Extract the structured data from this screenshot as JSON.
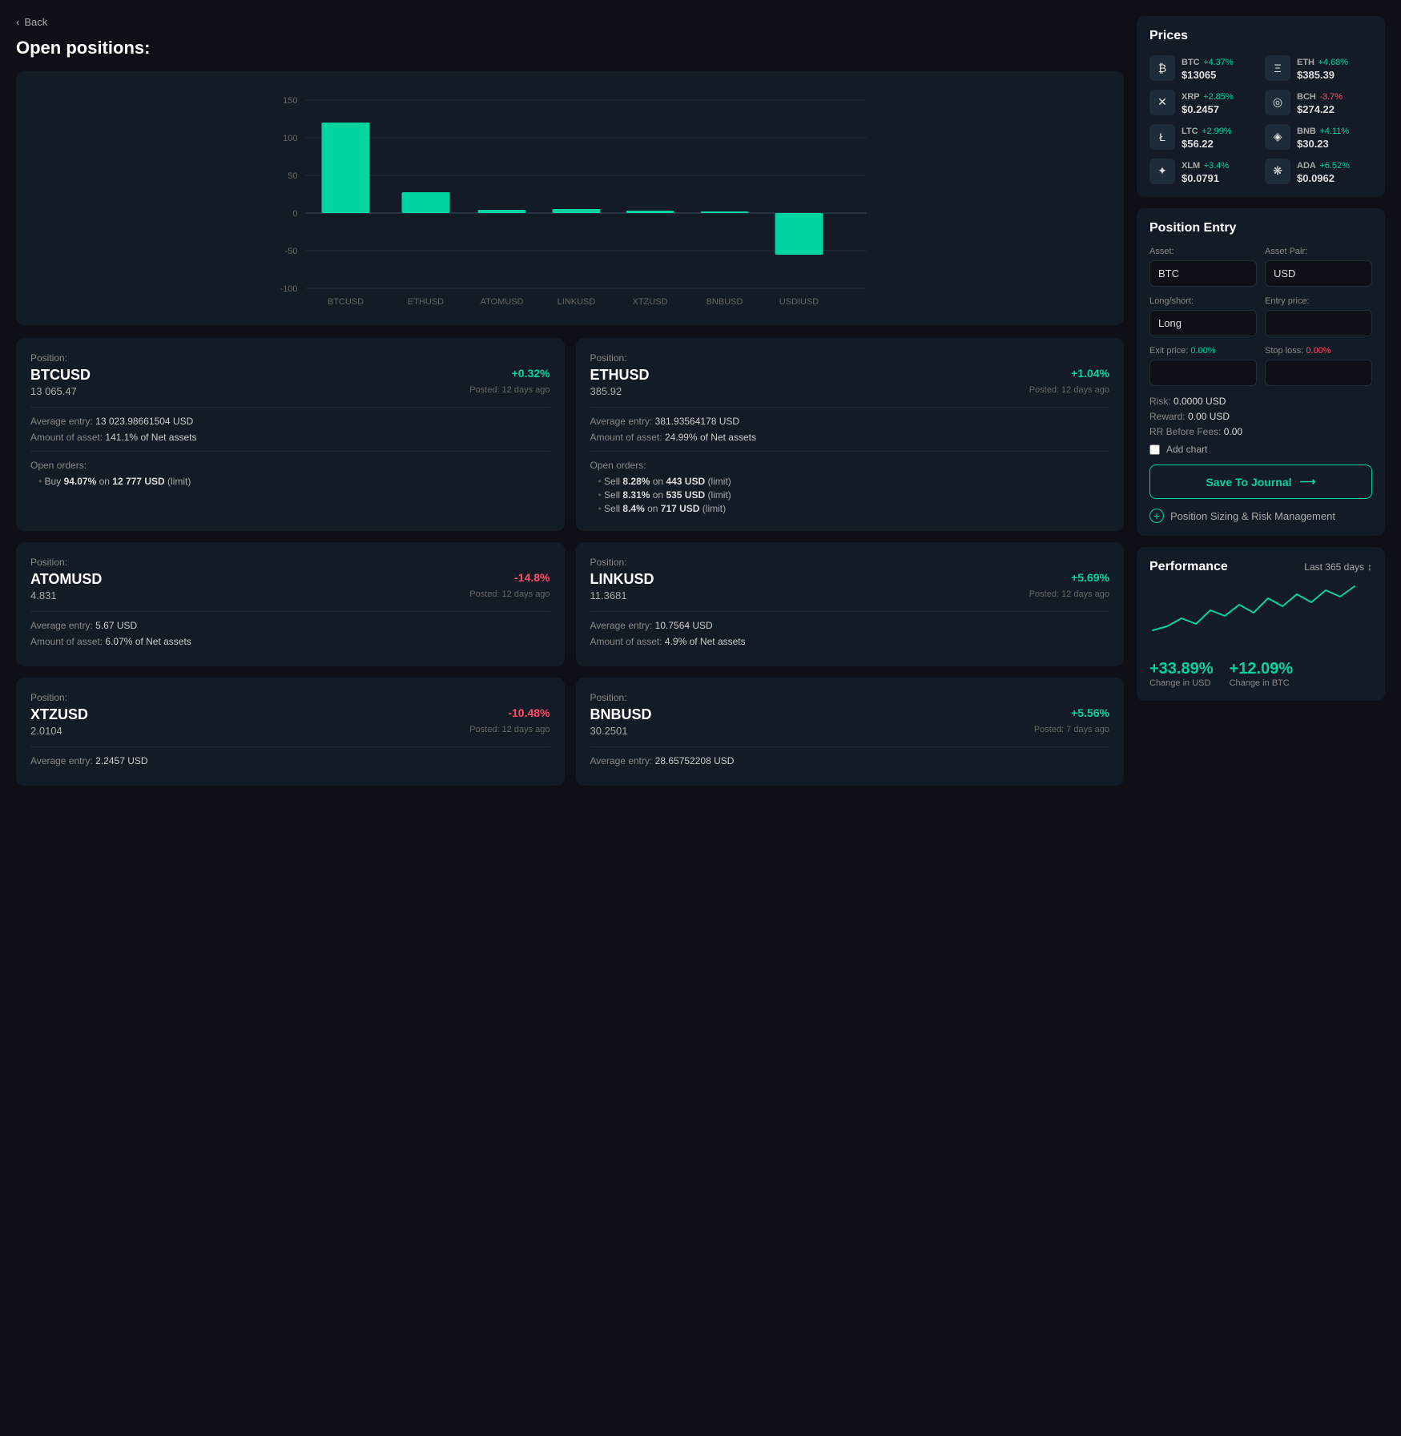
{
  "nav": {
    "back_label": "Back"
  },
  "page": {
    "title": "Open positions:"
  },
  "chart": {
    "bars": [
      {
        "label": "BTCUSD",
        "value": 120
      },
      {
        "label": "ETHUSD",
        "value": 28
      },
      {
        "label": "ATOMUSD",
        "value": 4
      },
      {
        "label": "LINKUSD",
        "value": 5
      },
      {
        "label": "XTZUSD",
        "value": 3
      },
      {
        "label": "BNBUSD",
        "value": 2
      },
      {
        "label": "USDIUSD",
        "value": -55
      }
    ],
    "y_labels": [
      "150",
      "100",
      "50",
      "0",
      "-50",
      "-100"
    ]
  },
  "positions": [
    {
      "label": "Position:",
      "name": "BTCUSD",
      "change": "+0.32%",
      "change_type": "pos",
      "price": "13 065.47",
      "posted": "Posted: 12 days ago",
      "avg_entry": "13 023.98661504 USD",
      "amount": "141.1%",
      "amount_label": "of Net assets",
      "orders_title": "Open orders:",
      "orders": [
        "Buy 94.07% on 12 777 USD (limit)"
      ]
    },
    {
      "label": "Position:",
      "name": "ETHUSD",
      "change": "+1.04%",
      "change_type": "pos",
      "price": "385.92",
      "posted": "Posted: 12 days ago",
      "avg_entry": "381.93564178 USD",
      "amount": "24.99%",
      "amount_label": "of Net assets",
      "orders_title": "Open orders:",
      "orders": [
        "Sell 8.28% on 443 USD (limit)",
        "Sell 8.31% on 535 USD (limit)",
        "Sell 8.4% on 717 USD (limit)"
      ]
    },
    {
      "label": "Position:",
      "name": "ATOMUSD",
      "change": "-14.8%",
      "change_type": "neg",
      "price": "4.831",
      "posted": "Posted: 12 days ago",
      "avg_entry": "5.67 USD",
      "amount": "6.07%",
      "amount_label": "of Net assets",
      "orders_title": "",
      "orders": []
    },
    {
      "label": "Position:",
      "name": "LINKUSD",
      "change": "+5.69%",
      "change_type": "pos",
      "price": "11.3681",
      "posted": "Posted: 12 days ago",
      "avg_entry": "10.7564 USD",
      "amount": "4.9%",
      "amount_label": "of Net assets",
      "orders_title": "",
      "orders": []
    },
    {
      "label": "Position:",
      "name": "XTZUSD",
      "change": "-10.48%",
      "change_type": "neg",
      "price": "2.0104",
      "posted": "Posted: 12 days ago",
      "avg_entry": "2.2457 USD",
      "amount": "",
      "amount_label": "",
      "orders_title": "",
      "orders": []
    },
    {
      "label": "Position:",
      "name": "BNBUSD",
      "change": "+5.56%",
      "change_type": "pos",
      "price": "30.2501",
      "posted": "Posted: 7 days ago",
      "avg_entry": "28.65752208 USD",
      "amount": "",
      "amount_label": "",
      "orders_title": "",
      "orders": []
    }
  ],
  "prices": {
    "title": "Prices",
    "items": [
      {
        "symbol": "BTC",
        "icon": "₿",
        "change": "+4.37%",
        "change_type": "pos",
        "value": "$13065"
      },
      {
        "symbol": "ETH",
        "icon": "Ξ",
        "change": "+4.68%",
        "change_type": "pos",
        "value": "$385.39"
      },
      {
        "symbol": "XRP",
        "icon": "✕",
        "change": "+2.85%",
        "change_type": "pos",
        "value": "$0.2457"
      },
      {
        "symbol": "BCH",
        "icon": "◎",
        "change": "-3.7%",
        "change_type": "neg",
        "value": "$274.22"
      },
      {
        "symbol": "LTC",
        "icon": "Ł",
        "change": "+2.99%",
        "change_type": "pos",
        "value": "$56.22"
      },
      {
        "symbol": "BNB",
        "icon": "◈",
        "change": "+4.11%",
        "change_type": "pos",
        "value": "$30.23"
      },
      {
        "symbol": "XLM",
        "icon": "✦",
        "change": "+3.4%",
        "change_type": "pos",
        "value": "$0.0791"
      },
      {
        "symbol": "ADA",
        "icon": "❋",
        "change": "+6.52%",
        "change_type": "pos",
        "value": "$0.0962"
      }
    ]
  },
  "position_entry": {
    "title": "Position Entry",
    "asset_label": "Asset:",
    "asset_value": "BTC",
    "asset_pair_label": "Asset Pair:",
    "asset_pair_value": "USD",
    "long_short_label": "Long/short:",
    "long_short_value": "Long",
    "entry_price_label": "Entry price:",
    "entry_price_value": "",
    "exit_price_label": "Exit price: 0.00%",
    "stop_loss_label": "Stop loss: 0.00%",
    "risk_label": "Risk:",
    "risk_value": "0.0000 USD",
    "reward_label": "Reward:",
    "reward_value": "0.00 USD",
    "rr_label": "RR Before Fees:",
    "rr_value": "0.00",
    "add_chart_label": "Add chart",
    "save_btn_label": "Save To Journal",
    "sizing_label": "Position Sizing & Risk Management"
  },
  "performance": {
    "title": "Performance",
    "period": "Last 365 days",
    "change_usd_value": "+33.89%",
    "change_usd_label": "Change in USD",
    "change_btc_value": "+12.09%",
    "change_btc_label": "Change in BTC",
    "chart_points": [
      10,
      8,
      12,
      9,
      14,
      11,
      16,
      13,
      18,
      15,
      20,
      17,
      22,
      19,
      25
    ]
  }
}
